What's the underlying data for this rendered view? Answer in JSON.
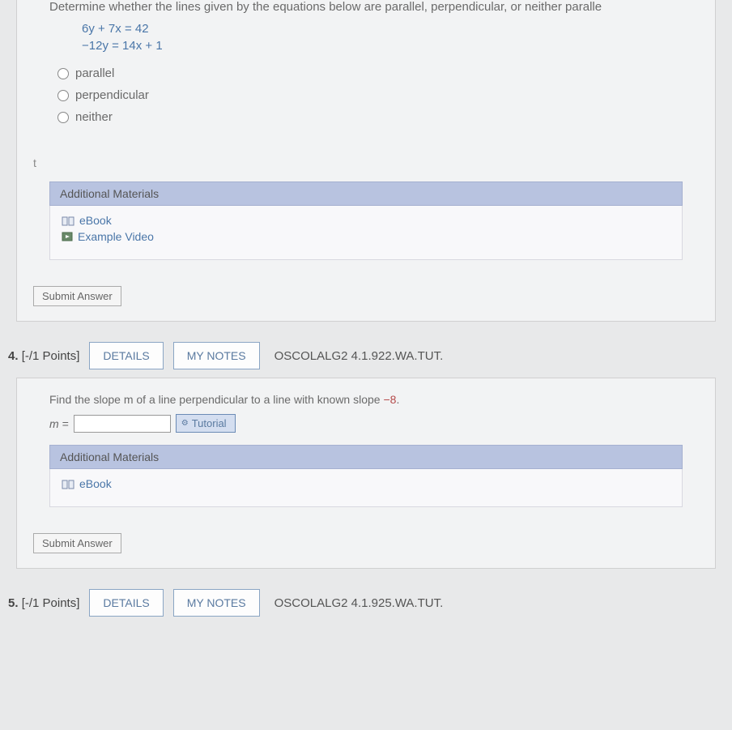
{
  "q3": {
    "prompt": "Determine whether the lines given by the equations below are parallel, perpendicular, or neither paralle",
    "eq1_left": "6y + 7x",
    "eq1_right": "= 42",
    "eq2_left": "−12y",
    "eq2_right": "= 14x + 1",
    "options": [
      "parallel",
      "perpendicular",
      "neither"
    ],
    "t_label": "t",
    "additional_header": "Additional Materials",
    "ebook_label": "eBook",
    "video_label": "Example Video",
    "submit_label": "Submit Answer"
  },
  "q4": {
    "number": "4.",
    "points": "[-/1 Points]",
    "details_btn": "DETAILS",
    "notes_btn": "MY NOTES",
    "source": "OSCOLALG2 4.1.922.WA.TUT.",
    "prompt_pre": "Find the slope m of a line perpendicular to a line with known slope ",
    "known_slope": "−8",
    "prompt_post": ".",
    "m_label": "m =",
    "tutorial_label": "Tutorial",
    "additional_header": "Additional Materials",
    "ebook_label": "eBook",
    "submit_label": "Submit Answer"
  },
  "q5": {
    "number": "5.",
    "points": "[-/1 Points]",
    "details_btn": "DETAILS",
    "notes_btn": "MY NOTES",
    "source": "OSCOLALG2 4.1.925.WA.TUT."
  }
}
